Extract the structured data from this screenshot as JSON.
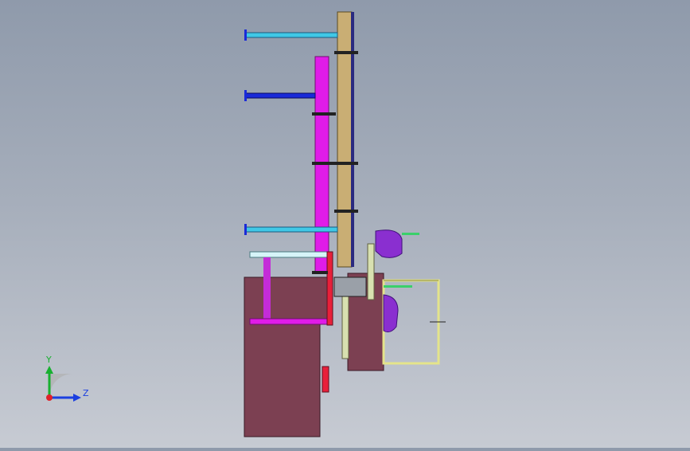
{
  "viewport": {
    "background_top": "#8f9aab",
    "background_bottom": "#c7cbd3"
  },
  "axis_triad": {
    "y_label": "Y",
    "z_label": "Z",
    "x_color": "#e0202a",
    "y_color": "#18b030",
    "z_color": "#1b3fe0"
  },
  "colors": {
    "tan_plate": "#c9ae74",
    "magenta_plate": "#e01ce8",
    "cyan_arm": "#40c8e6",
    "blue_arm": "#1a2ad8",
    "base_maroon": "#7c4052",
    "red_bar": "#e8203a",
    "purple_motor": "#8a2fd0",
    "frame_yellow": "#e4e48a",
    "green_rod": "#3ad06a"
  }
}
